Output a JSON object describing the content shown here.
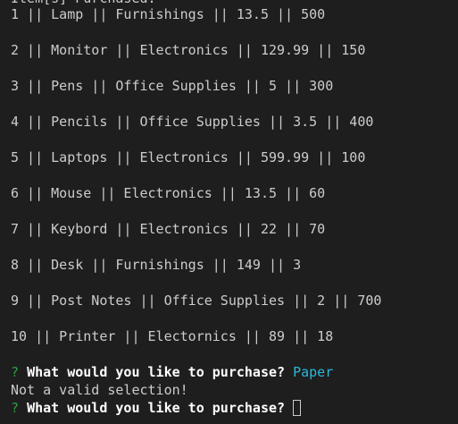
{
  "clipped_header": "Item[s] Purchased:",
  "rows": [
    {
      "text": "1 || Lamp || Furnishings || 13.5 || 500"
    },
    {
      "text": "2 || Monitor || Electronics || 129.99 || 150"
    },
    {
      "text": "3 || Pens || Office Supplies || 5 || 300"
    },
    {
      "text": "4 || Pencils || Office Supplies || 3.5 || 400"
    },
    {
      "text": "5 || Laptops || Electronics || 599.99 || 100"
    },
    {
      "text": "6 || Mouse || Electronics || 13.5 || 60"
    },
    {
      "text": "7 || Keybord || Electronics || 22 || 70"
    },
    {
      "text": "8 || Desk || Furnishings || 149 || 3"
    },
    {
      "text": "9 || Post Notes || Office Supplies || 2 || 700"
    },
    {
      "text": "10 || Printer || Electornics || 89 || 18"
    }
  ],
  "prompt1": {
    "mark": "?",
    "question": "What would you like to purchase?",
    "answer": "Paper"
  },
  "error_message": "Not a valid selection!",
  "prompt2": {
    "mark": "?",
    "question": "What would you like to purchase?"
  }
}
